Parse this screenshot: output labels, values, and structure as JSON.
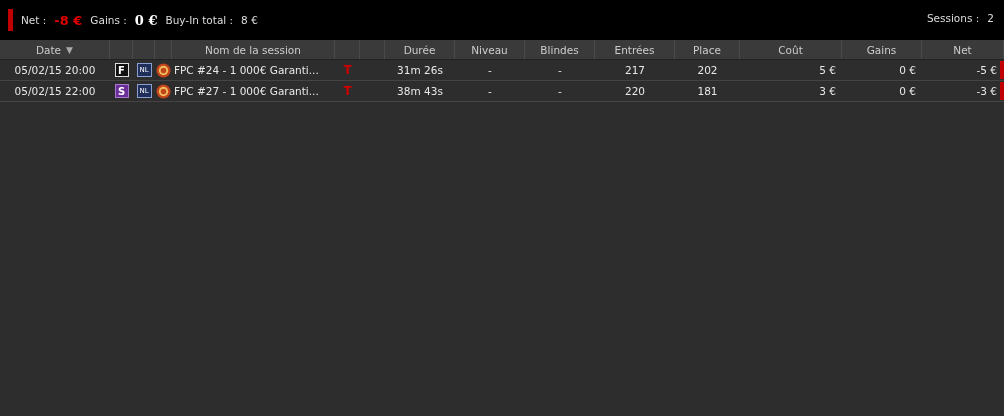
{
  "summary": {
    "net_label": "Net :",
    "net_value": "-8 €",
    "gains_label": "Gains :",
    "gains_value": "0 €",
    "buyin_label": "Buy-In total :",
    "buyin_value": "8 €",
    "sessions_label": "Sessions :",
    "sessions_value": "2"
  },
  "table": {
    "columns": [
      {
        "label": "Date",
        "sort": "▼"
      },
      {
        "label": "Nom de la session"
      },
      {
        "label": "Durée"
      },
      {
        "label": "Niveau"
      },
      {
        "label": "Blindes"
      },
      {
        "label": "Entrées"
      },
      {
        "label": "Place"
      },
      {
        "label": "Coût"
      },
      {
        "label": "Gains"
      },
      {
        "label": "Net"
      }
    ],
    "rows": [
      {
        "date": "05/02/15 20:00",
        "badge": {
          "label": "F",
          "kind": "outline"
        },
        "limit": "NL",
        "name": "FPC #24 - 1 000€ Garanti...",
        "type": "T",
        "duration": "31m 26s",
        "level": "-",
        "blinds": "-",
        "entries": "217",
        "place": "202",
        "cost": "5 €",
        "gains": "0 €",
        "net": "-5 €",
        "loss": true
      },
      {
        "date": "05/02/15 22:00",
        "badge": {
          "label": "S",
          "kind": "filled"
        },
        "limit": "NL",
        "name": "FPC #27 - 1 000€ Garanti...",
        "type": "T",
        "duration": "38m 43s",
        "level": "-",
        "blinds": "-",
        "entries": "220",
        "place": "181",
        "cost": "3 €",
        "gains": "0 €",
        "net": "-3 €",
        "loss": true
      }
    ]
  }
}
